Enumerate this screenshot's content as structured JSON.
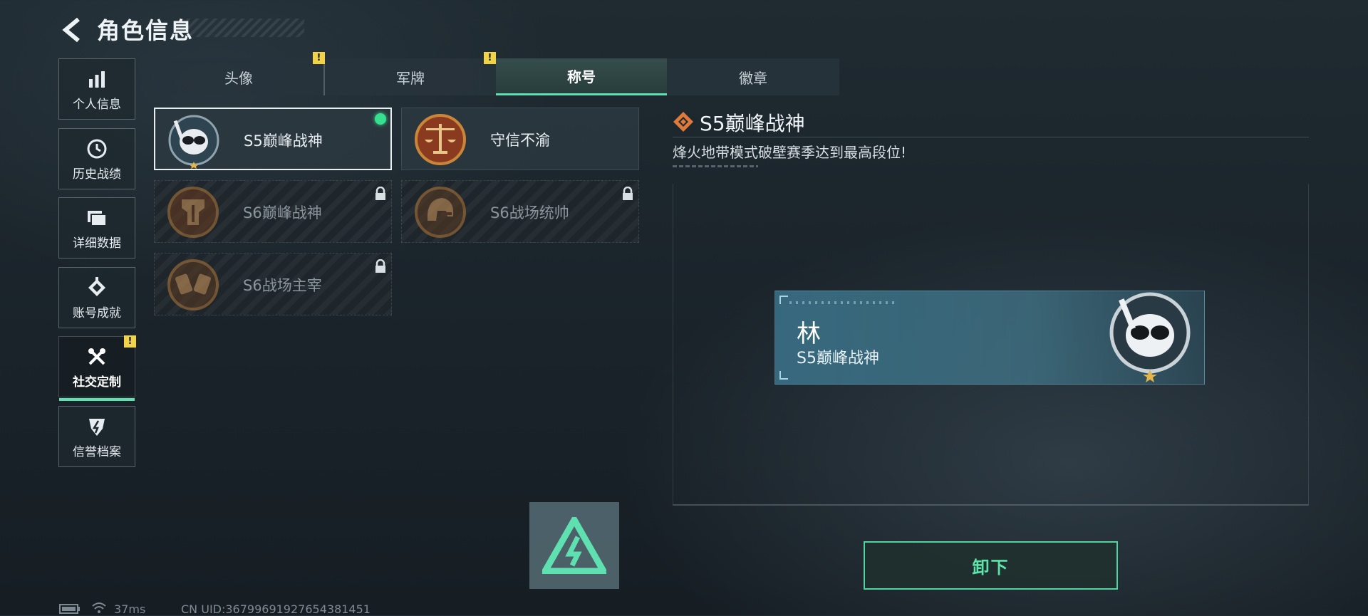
{
  "header": {
    "title": "角色信息"
  },
  "sidebar": {
    "items": [
      {
        "label": "个人信息",
        "icon": "bar-chart-icon"
      },
      {
        "label": "历史战绩",
        "icon": "history-icon"
      },
      {
        "label": "详细数据",
        "icon": "folder-icon"
      },
      {
        "label": "账号成就",
        "icon": "achievement-icon"
      },
      {
        "label": "社交定制",
        "icon": "wrench-screwdriver-icon",
        "active": true,
        "alert": "!"
      },
      {
        "label": "信誉档案",
        "icon": "shield-icon"
      }
    ]
  },
  "tabs": [
    {
      "label": "头像",
      "alert": "!"
    },
    {
      "label": "军牌",
      "alert": "!"
    },
    {
      "label": "称号",
      "active": true
    },
    {
      "label": "徽章"
    }
  ],
  "titles": [
    {
      "label": "S5巅峰战神",
      "emblem": "diver-skull-emblem",
      "selected": true,
      "equipped": true
    },
    {
      "label": "守信不渝",
      "emblem": "scales-emblem"
    },
    {
      "label": "S6巅峰战神",
      "emblem": "helmet-emblem",
      "locked": true
    },
    {
      "label": "S6战场统帅",
      "emblem": "warrior-helmet-emblem",
      "locked": true
    },
    {
      "label": "S6战场主宰",
      "emblem": "fists-emblem",
      "locked": true
    }
  ],
  "detail": {
    "name": "S5巅峰战神",
    "description": "烽火地带模式破壁赛季达到最高段位!"
  },
  "name_card": {
    "player_name": "林",
    "title": "S5巅峰战神"
  },
  "actions": {
    "unequip_label": "卸下"
  },
  "status": {
    "ping": "37ms",
    "uid": "CN UID:36799691927654381451"
  },
  "colors": {
    "accent": "#5fe0b0",
    "alert": "#f1d34a",
    "equipped": "#36e08f"
  }
}
